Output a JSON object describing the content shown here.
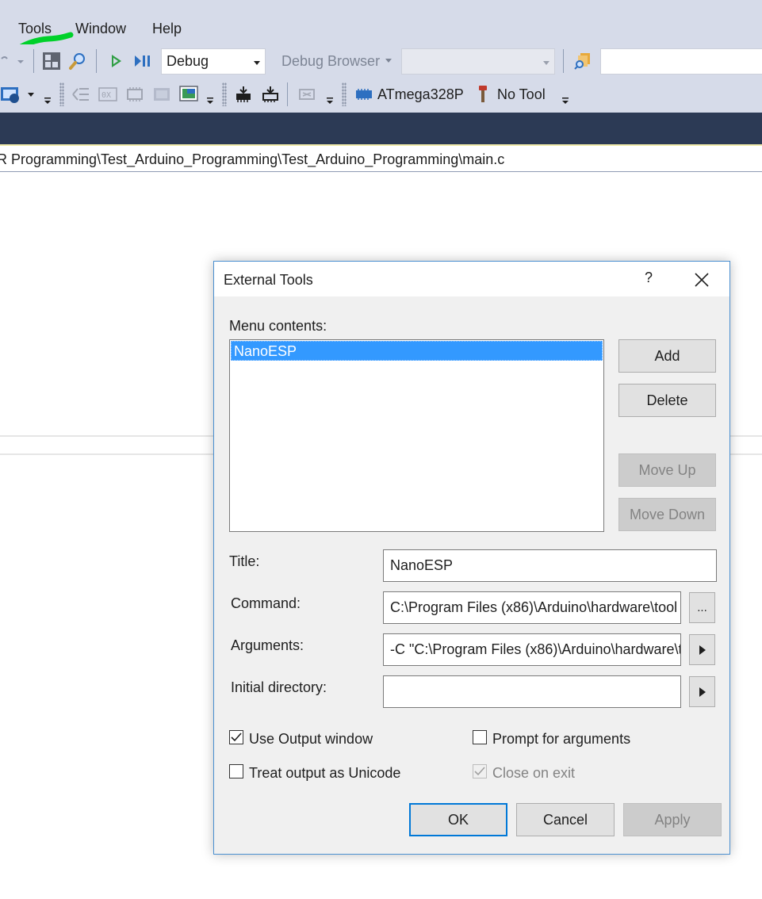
{
  "menubar": {
    "items": [
      "Tools",
      "Window",
      "Help"
    ],
    "highlight_color": "#00d12a"
  },
  "toolbar": {
    "config_value": "Debug",
    "debug_browser_label": "Debug Browser",
    "platform_value": "",
    "find_value": "",
    "device_label": "ATmega328P",
    "tool_label": "No Tool"
  },
  "path_bar": {
    "text": "R Programming\\Test_Arduino_Programming\\Test_Arduino_Programming\\main.c"
  },
  "dialog": {
    "title": "External Tools",
    "help_glyph": "?",
    "menu_contents_label": "Menu contents:",
    "menu_items": [
      "NanoESP"
    ],
    "selected_index": 0,
    "buttons": {
      "add": "Add",
      "delete": "Delete",
      "move_up": "Move Up",
      "move_down": "Move Down",
      "ok": "OK",
      "cancel": "Cancel",
      "apply": "Apply"
    },
    "fields": {
      "title_label": "Title:",
      "title_value": "NanoESP",
      "command_label": "Command:",
      "command_value": "C:\\Program Files (x86)\\Arduino\\hardware\\tool",
      "command_browse": "...",
      "arguments_label": "Arguments:",
      "arguments_value": "-C \"C:\\Program Files (x86)\\Arduino\\hardware\\t",
      "initial_dir_label": "Initial directory:",
      "initial_dir_value": ""
    },
    "options": {
      "use_output_window": {
        "label": "Use Output window",
        "checked": true,
        "enabled": true
      },
      "prompt_for_arguments": {
        "label": "Prompt for arguments",
        "checked": false,
        "enabled": true
      },
      "treat_output_unicode": {
        "label": "Treat output as Unicode",
        "checked": false,
        "enabled": true
      },
      "close_on_exit": {
        "label": "Close on exit",
        "checked": true,
        "enabled": false
      }
    }
  },
  "colors": {
    "chrome": "#d6dbe9",
    "dark_band": "#2c3a55",
    "selection": "#3399ff",
    "dialog_bg": "#f0f0f0",
    "default_button_border": "#0078d7"
  }
}
